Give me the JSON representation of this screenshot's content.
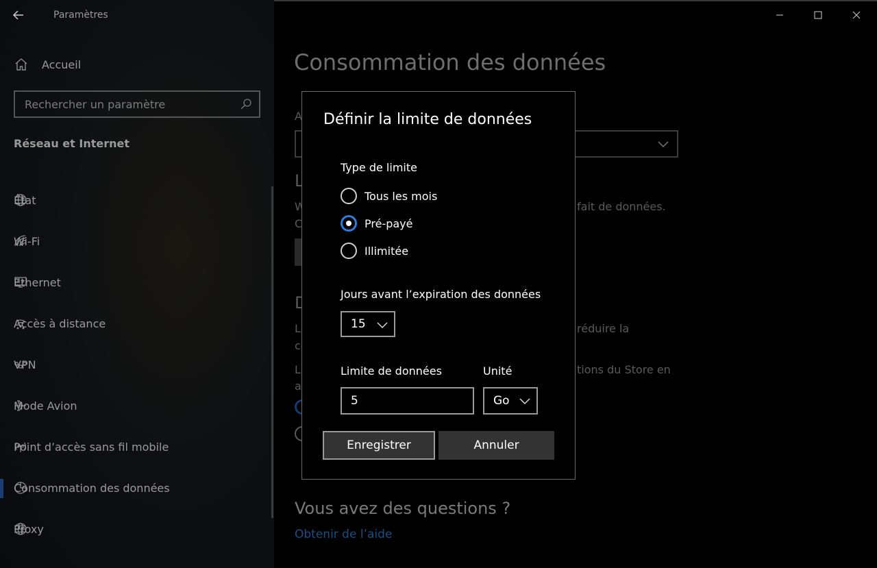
{
  "window": {
    "title": "Paramètres",
    "controls": {
      "minimize": "—",
      "maximize": "☐",
      "close": "✕"
    }
  },
  "sidebar": {
    "home_label": "Accueil",
    "search_placeholder": "Rechercher un paramètre",
    "section_header": "Réseau et Internet",
    "items": [
      {
        "label": "État",
        "icon": "globe-icon",
        "active": false
      },
      {
        "label": "Wi-Fi",
        "icon": "wifi-icon",
        "active": false
      },
      {
        "label": "Ethernet",
        "icon": "ethernet-icon",
        "active": false
      },
      {
        "label": "Accès à distance",
        "icon": "dialup-icon",
        "active": false
      },
      {
        "label": "VPN",
        "icon": "vpn-icon",
        "active": false
      },
      {
        "label": "Mode Avion",
        "icon": "airplane-icon",
        "active": false
      },
      {
        "label": "Point d’accès sans fil mobile",
        "icon": "hotspot-icon",
        "active": false
      },
      {
        "label": "Consommation des données",
        "icon": "pie-chart-icon",
        "active": true
      },
      {
        "label": "Proxy",
        "icon": "globe-icon",
        "active": false
      }
    ]
  },
  "main": {
    "title": "Consommation des données",
    "fragments": {
      "a": "A",
      "l": "L",
      "w": "W",
      "c": "C",
      "forfait": "fait de données.",
      "d": "D",
      "li1": "Li",
      "co": "co",
      "reduire": "réduire la",
      "li2": "Li",
      "ar": "ar",
      "store": "tions du Store en"
    },
    "questions": "Vous avez des questions ?",
    "help_link": "Obtenir de l’aide"
  },
  "dialog": {
    "title": "Définir la limite de données",
    "limit_type_label": "Type de limite",
    "options": [
      {
        "label": "Tous les mois",
        "checked": false
      },
      {
        "label": "Pré-payé",
        "checked": true
      },
      {
        "label": "Illimitée",
        "checked": false
      }
    ],
    "days_label": "Jours avant l’expiration des données",
    "days_value": "15",
    "limit_label": "Limite de données",
    "limit_value": "5",
    "unit_label": "Unité",
    "unit_value": "Go",
    "save_label": "Enregistrer",
    "cancel_label": "Annuler"
  },
  "colors": {
    "accent": "#2a7fdc",
    "active_indicator": "#1a3d73",
    "link": "#1c4f82"
  }
}
